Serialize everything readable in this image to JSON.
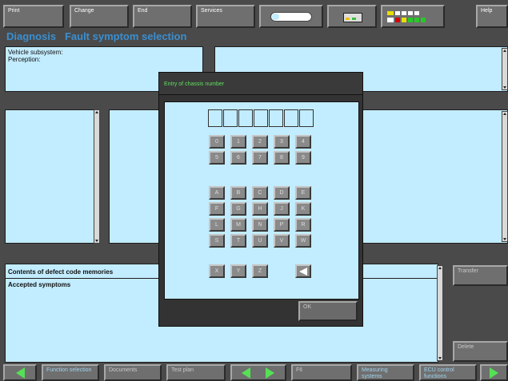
{
  "toolbar": {
    "print": "Print",
    "change": "Change",
    "end": "End",
    "services": "Services",
    "help": "Help"
  },
  "title": "Diagnosis   Fault symptom selection",
  "info_panel": {
    "vehicle_subsystem": "Vehicle subsystem:",
    "perception": "Perception:"
  },
  "dialog": {
    "title": "Entry of chassis number",
    "slot_count": 7,
    "digits_row1": [
      "0",
      "1",
      "2",
      "3",
      "4"
    ],
    "digits_row2": [
      "5",
      "6",
      "7",
      "8",
      "9"
    ],
    "letters_row1": [
      "A",
      "B",
      "C",
      "D",
      "E"
    ],
    "letters_row2": [
      "F",
      "G",
      "H",
      "J",
      "K"
    ],
    "letters_row3": [
      "L",
      "M",
      "N",
      "P",
      "R"
    ],
    "letters_row4": [
      "S",
      "T",
      "U",
      "V",
      "W"
    ],
    "letters_row5": [
      "X",
      "Y",
      "Z"
    ],
    "ok": "OK"
  },
  "memory_panel": {
    "contents": "Contents of defect code memories",
    "accepted": "Accepted symptoms"
  },
  "side_buttons": {
    "transfer": "Transfer",
    "delete": "Delete"
  },
  "bottom_bar": {
    "function_selection": "Function selection",
    "documents": "Documents",
    "test_plan": "Test plan",
    "f6": "F6",
    "measuring_systems": "Measuring systems",
    "ecu_control": "ECU control functions"
  },
  "colors": {
    "panel_bg": "#c2ecff",
    "frame_bg": "#4a4a4a",
    "title_blue": "#3a8fd0",
    "dialog_title": "#5fe05f",
    "arrow_green": "#55e055"
  }
}
